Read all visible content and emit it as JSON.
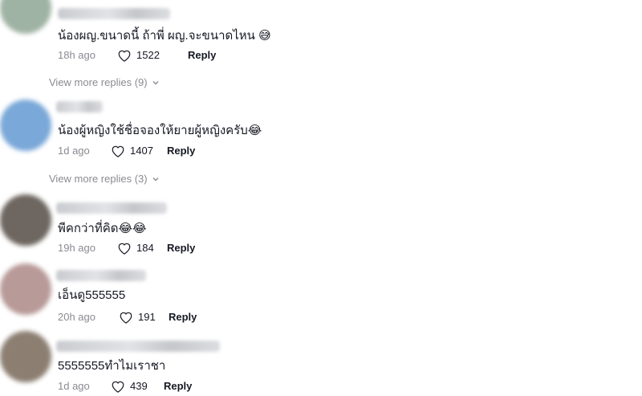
{
  "comments": [
    {
      "text": "น้องผญ.ขนาดนี้ ถ้าพี่ ผญ.จะขนาดไหน",
      "emoji": "😅",
      "time": "18h ago",
      "likes": "1522",
      "reply_label": "Reply",
      "avatar_color": "#9fb3a4"
    },
    {
      "text": "น้องผู้หญิงใช้ชื่อจองให้ยายผู้หญิงครับ",
      "emoji": "😂",
      "time": "1d ago",
      "likes": "1407",
      "reply_label": "Reply",
      "avatar_color": "#7aa8d8"
    },
    {
      "text": "พีคกว่าที่คิด",
      "emoji": "😂😂",
      "time": "19h ago",
      "likes": "184",
      "reply_label": "Reply",
      "avatar_color": "#6e6660"
    },
    {
      "text": "เอ็นดู555555",
      "emoji": "",
      "time": "20h ago",
      "likes": "191",
      "reply_label": "Reply",
      "avatar_color": "#b89a98"
    },
    {
      "text": "5555555ทำไมเราชา",
      "emoji": "",
      "time": "1d ago",
      "likes": "439",
      "reply_label": "Reply",
      "avatar_color": "#8c7f72"
    }
  ],
  "view_more": [
    {
      "label": "View more replies (9)"
    },
    {
      "label": "View more replies (3)"
    }
  ]
}
